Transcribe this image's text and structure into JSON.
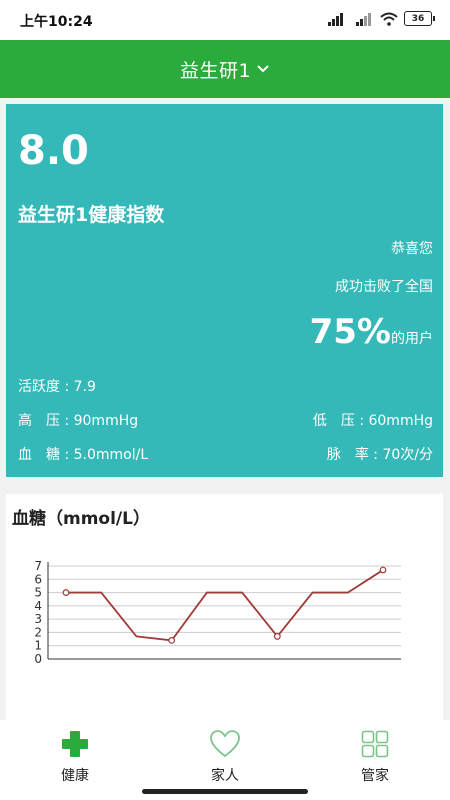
{
  "status_bar": {
    "time": "上午10:24",
    "battery": "36"
  },
  "header": {
    "title": "益生研1",
    "dropdown_icon": "chevron-down-icon"
  },
  "health": {
    "score": "8.0",
    "index_title": "益生研1健康指数",
    "congrats": "恭喜您",
    "beat_text": "成功击败了全国",
    "percent": "75%",
    "percent_suffix": "的用户",
    "activity": "活跃度 : 7.9",
    "high_pressure": "高　压 : 90mmHg",
    "low_pressure": "低　压 : 60mmHg",
    "blood_sugar": "血　糖 : 5.0mmol/L",
    "pulse": "脉　率 : 70次/分"
  },
  "chart_title": "血糖（mmol/L）",
  "chart_data": {
    "type": "line",
    "title": "血糖（mmol/L）",
    "xlabel": "",
    "ylabel": "",
    "ylim": [
      0,
      7
    ],
    "yticks": [
      "0",
      "1",
      "2",
      "3",
      "4",
      "5",
      "6",
      "7"
    ],
    "grid": true,
    "series": [
      {
        "values": [
          5.0,
          5.0,
          1.7,
          1.4,
          5.0,
          5.0,
          1.7,
          5.0,
          5.0,
          6.7
        ],
        "markers": [
          true,
          false,
          false,
          true,
          false,
          false,
          true,
          false,
          false,
          true
        ]
      }
    ],
    "colors": {
      "line": "#a03a36",
      "grid": "#cccccc",
      "axis": "#333333"
    }
  },
  "nav": {
    "items": [
      {
        "label": "健康",
        "icon": "plus-cross-icon"
      },
      {
        "label": "家人",
        "icon": "heart-icon"
      },
      {
        "label": "管家",
        "icon": "grid-icon"
      }
    ]
  },
  "colors": {
    "header": "#2bab3c",
    "card": "#34b8b8"
  }
}
